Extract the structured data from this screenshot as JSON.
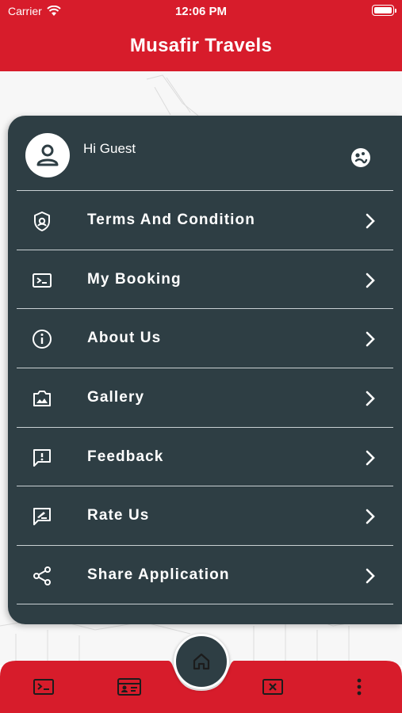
{
  "status_bar": {
    "carrier": "Carrier",
    "time": "12:06 PM"
  },
  "header": {
    "title": "Musafir Travels"
  },
  "drawer": {
    "greeting": "Hi Guest",
    "items": [
      {
        "label": "Terms And Condition",
        "icon": "shield-icon"
      },
      {
        "label": "My Booking",
        "icon": "ticket-icon"
      },
      {
        "label": "About Us",
        "icon": "info-icon"
      },
      {
        "label": "Gallery",
        "icon": "gallery-icon"
      },
      {
        "label": "Feedback",
        "icon": "feedback-icon"
      },
      {
        "label": "Rate Us",
        "icon": "rate-icon"
      },
      {
        "label": "Share Application",
        "icon": "share-icon"
      }
    ]
  },
  "bottom_nav": {
    "items": [
      "ticket-icon",
      "id-card-icon",
      "cancel-ticket-icon",
      "more-vertical-icon"
    ],
    "center": "home-icon"
  },
  "colors": {
    "brand_red": "#d71c2b",
    "drawer_bg": "#2e3e44",
    "background": "#f7f7f7"
  }
}
